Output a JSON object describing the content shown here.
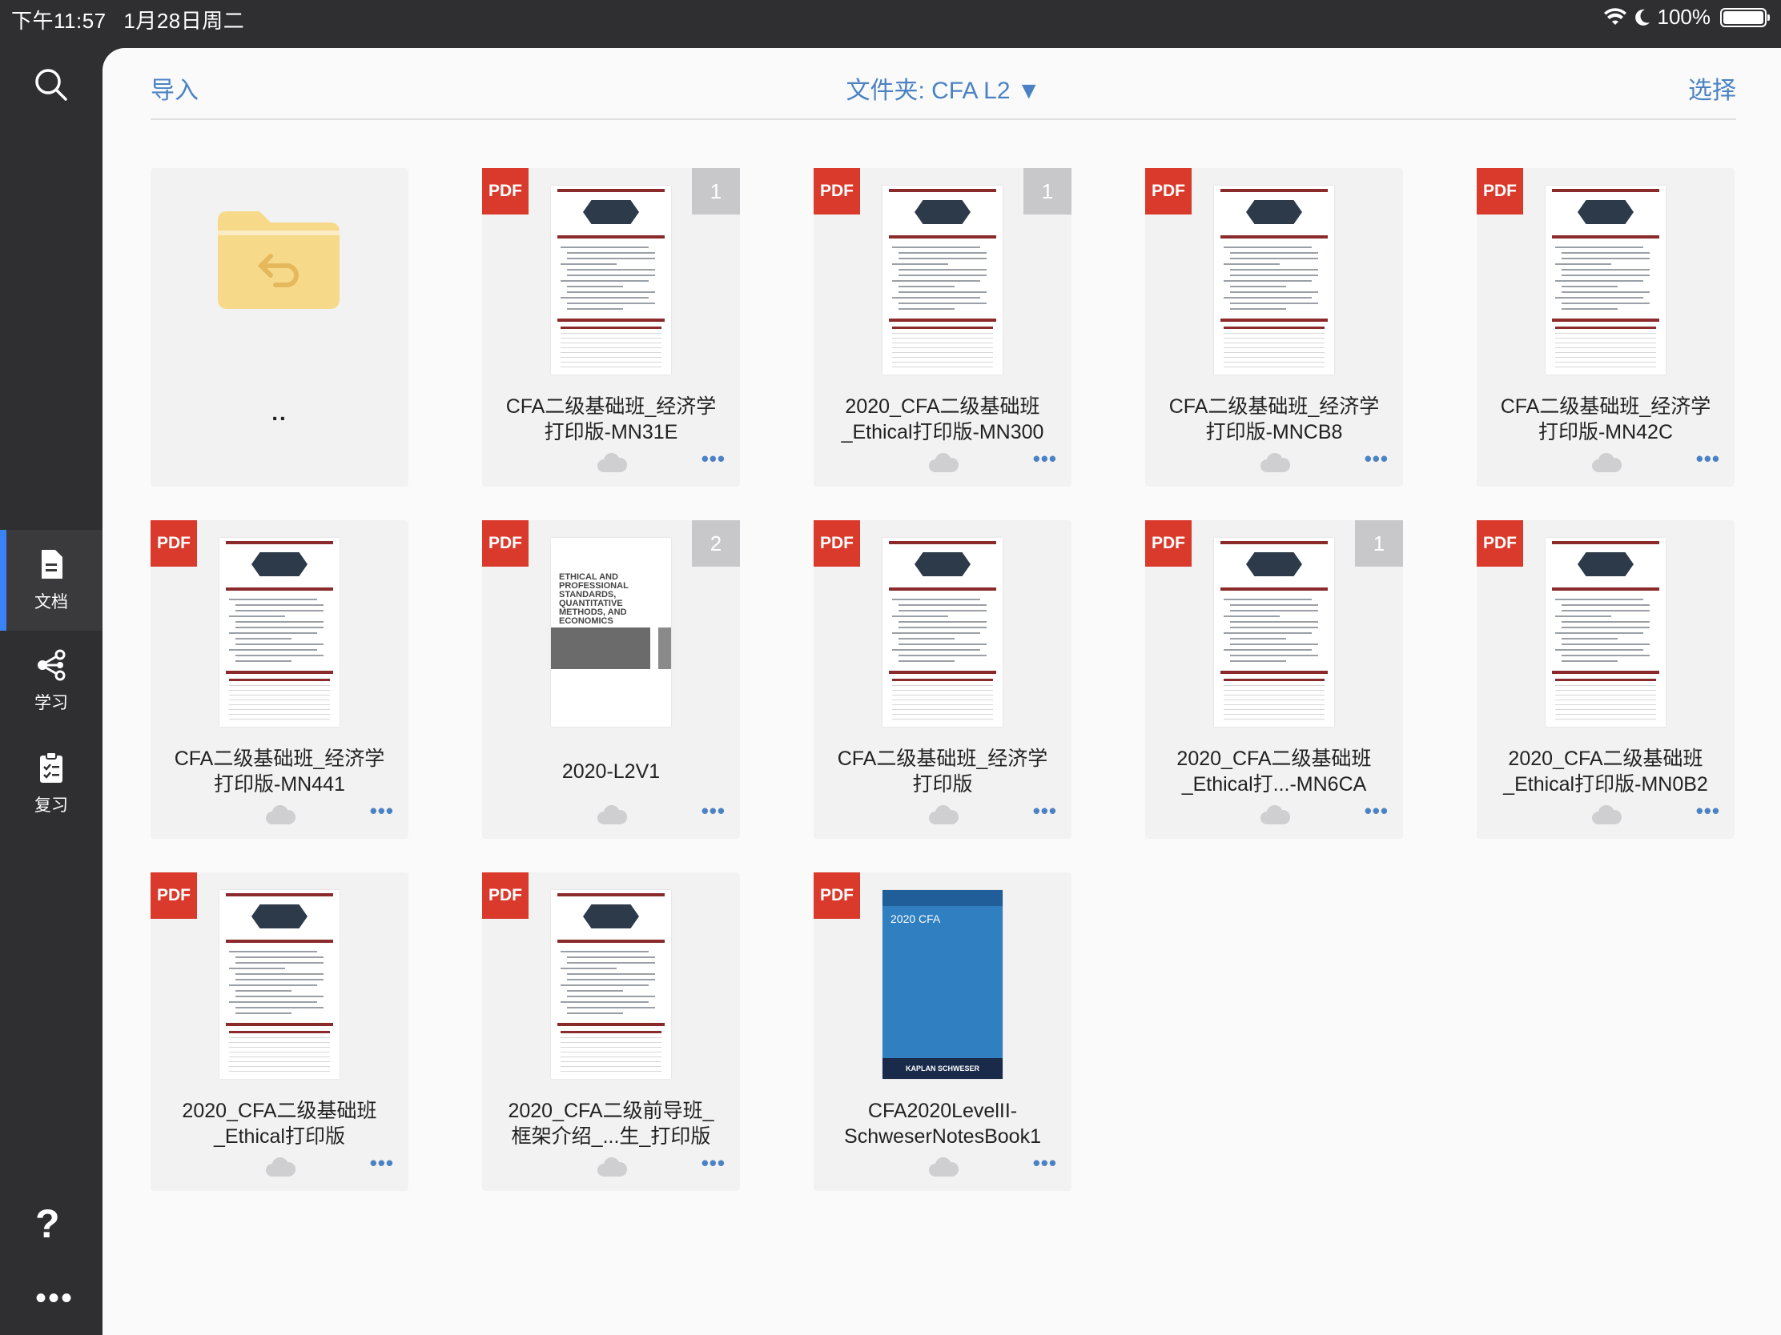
{
  "status_bar": {
    "time": "下午11:57",
    "date": "1月28日周二",
    "battery": "100%",
    "icons": [
      "wifi-icon",
      "moon-icon",
      "battery-icon"
    ]
  },
  "sidebar": {
    "items": [
      {
        "label": "文档",
        "icon": "document-icon",
        "active": true
      },
      {
        "label": "学习",
        "icon": "share-nodes-icon",
        "active": false
      },
      {
        "label": "复习",
        "icon": "clipboard-check-icon",
        "active": false
      }
    ],
    "help": "?",
    "more": "•••"
  },
  "topbar": {
    "import_label": "导入",
    "folder_title": "文件夹: CFA L2 ▼",
    "select_label": "选择"
  },
  "files": [
    {
      "kind": "folder-up",
      "title": ".."
    },
    {
      "kind": "pdf",
      "title": "CFA二级基础班_经济学\n打印版-MN31E",
      "badge": "1",
      "thumb": "economics"
    },
    {
      "kind": "pdf",
      "title": "2020_CFA二级基础班\n_Ethical打印版-MN300",
      "badge": "1",
      "thumb": "ethical"
    },
    {
      "kind": "pdf",
      "title": "CFA二级基础班_经济学\n打印版-MNCB8",
      "badge": "",
      "thumb": "economics"
    },
    {
      "kind": "pdf",
      "title": "CFA二级基础班_经济学\n打印版-MN42C",
      "badge": "",
      "thumb": "economics"
    },
    {
      "kind": "pdf",
      "title": "CFA二级基础班_经济学\n打印版-MN441",
      "badge": "",
      "thumb": "economics"
    },
    {
      "kind": "pdf",
      "title": "2020-L2V1",
      "badge": "2",
      "thumb": "l2v1"
    },
    {
      "kind": "pdf",
      "title": "CFA二级基础班_经济学\n打印版",
      "badge": "",
      "thumb": "economics"
    },
    {
      "kind": "pdf",
      "title": "2020_CFA二级基础班\n_Ethical打...-MN6CA",
      "badge": "1",
      "thumb": "ethical"
    },
    {
      "kind": "pdf",
      "title": "2020_CFA二级基础班\n_Ethical打印版-MN0B2",
      "badge": "",
      "thumb": "ethical"
    },
    {
      "kind": "pdf",
      "title": "2020_CFA二级基础班\n_Ethical打印版",
      "badge": "",
      "thumb": "ethical"
    },
    {
      "kind": "pdf",
      "title": "2020_CFA二级前导班_\n框架介绍_...生_打印版",
      "badge": "",
      "thumb": "intro"
    },
    {
      "kind": "pdf",
      "title": "CFA2020LevelII-\nSchweserNotesBook1",
      "badge": "",
      "thumb": "schweser"
    }
  ],
  "labels": {
    "pdf_tag": "PDF",
    "more": "•••",
    "l2v1_cover_text": "ETHICAL AND\nPROFESSIONAL\nSTANDARDS,\nQUANTITATIVE\nMETHODS, AND\nECONOMICS",
    "schweser_cover_top": "2020 CFA",
    "schweser_cover_band": "KAPLAN SCHWESER"
  },
  "colors": {
    "accent": "#4a82c4",
    "pdf_red": "#d93a2b",
    "sidebar_bg": "#2f2f31",
    "active_indicator": "#3a82f7",
    "folder_yellow": "#f7d98a"
  }
}
